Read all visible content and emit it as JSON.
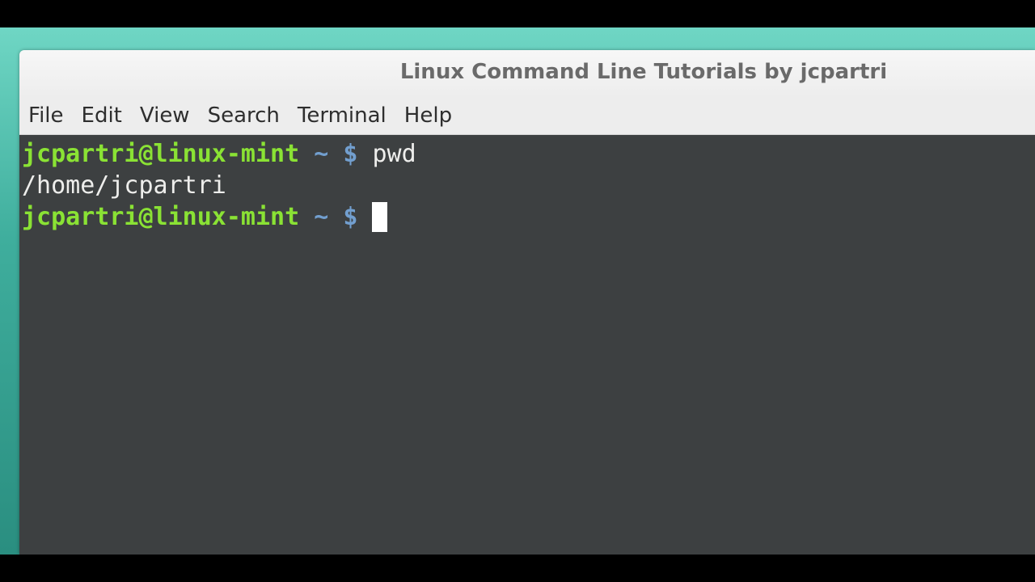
{
  "window": {
    "title": "Linux Command Line Tutorials by jcpartri"
  },
  "menubar": {
    "items": [
      "File",
      "Edit",
      "View",
      "Search",
      "Terminal",
      "Help"
    ]
  },
  "terminal": {
    "lines": [
      {
        "user_host": "jcpartri@linux-mint",
        "path": "~",
        "prompt": "$",
        "command": "pwd"
      },
      {
        "output": "/home/jcpartri"
      },
      {
        "user_host": "jcpartri@linux-mint",
        "path": "~",
        "prompt": "$",
        "command": ""
      }
    ]
  },
  "colors": {
    "terminal_bg": "#3d4041",
    "user_host": "#8ae234",
    "prompt_symbols": "#729fcf",
    "text": "#eeeeec",
    "desktop": "#3fae9d"
  }
}
